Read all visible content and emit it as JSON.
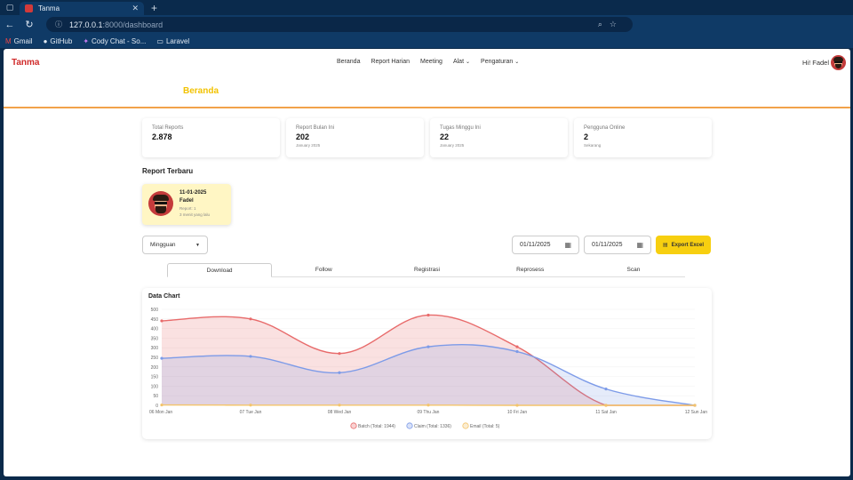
{
  "browser": {
    "tab_title": "Tanma",
    "url_host": "127.0.0.1",
    "url_rest": ":8000/dashboard",
    "bookmarks": [
      {
        "label": "Gmail",
        "icon": "gmail-icon"
      },
      {
        "label": "GitHub",
        "icon": "github-icon"
      },
      {
        "label": "Cody Chat - So...",
        "icon": "cody-icon"
      },
      {
        "label": "Laravel",
        "icon": "folder-icon"
      }
    ]
  },
  "nav": {
    "brand": "Tanma",
    "menu": [
      "Beranda",
      "Report Harian",
      "Meeting",
      "Alat",
      "Pengaturan"
    ],
    "greeting": "Hi! Fadel"
  },
  "page": {
    "title": "Beranda"
  },
  "stats": [
    {
      "label": "Total Reports",
      "value": "2.878",
      "sub": ""
    },
    {
      "label": "Report Bulan Ini",
      "value": "202",
      "sub": "January 2025"
    },
    {
      "label": "Tugas Minggu Ini",
      "value": "22",
      "sub": "January 2025"
    },
    {
      "label": "Pengguna Online",
      "value": "2",
      "sub": "Sekarang"
    }
  ],
  "recent": {
    "title": "Report Terbaru",
    "date": "11-01-2025",
    "name": "Fadel",
    "report": "Report: 1",
    "time": "3 menit yang lalu"
  },
  "filters": {
    "period": "Mingguan",
    "date_from": "01/11/2025",
    "date_to": "01/11/2025",
    "export_label": "Export Excel"
  },
  "tabs": [
    "Download",
    "Follow",
    "Registrasi",
    "Reprosess",
    "Scan"
  ],
  "colors": {
    "brand": "#d02a2a",
    "accent": "#f2c200",
    "export": "#f7cf10"
  },
  "chart_data": {
    "type": "area",
    "title": "Data Chart",
    "categories": [
      "06 Mon Jan",
      "07 Tue Jan",
      "08 Wed Jan",
      "09 Thu Jan",
      "10 Fri Jan",
      "11 Sat Jan",
      "12 Sun Jan"
    ],
    "ylim": [
      0,
      500
    ],
    "yticks": [
      0,
      50,
      100,
      150,
      200,
      250,
      300,
      350,
      400,
      450,
      500
    ],
    "series": [
      {
        "name": "Batch (Total: 1944)",
        "values": [
          440,
          450,
          270,
          470,
          305,
          0,
          0
        ],
        "color": "#e86b6b"
      },
      {
        "name": "Claim (Total: 1336)",
        "values": [
          245,
          255,
          170,
          305,
          280,
          85,
          0
        ],
        "color": "#7d9be8"
      },
      {
        "name": "Email (Total: 5)",
        "values": [
          2,
          1,
          1,
          1,
          0,
          0,
          0
        ],
        "color": "#f3c46b"
      }
    ],
    "legend": "bottom"
  }
}
